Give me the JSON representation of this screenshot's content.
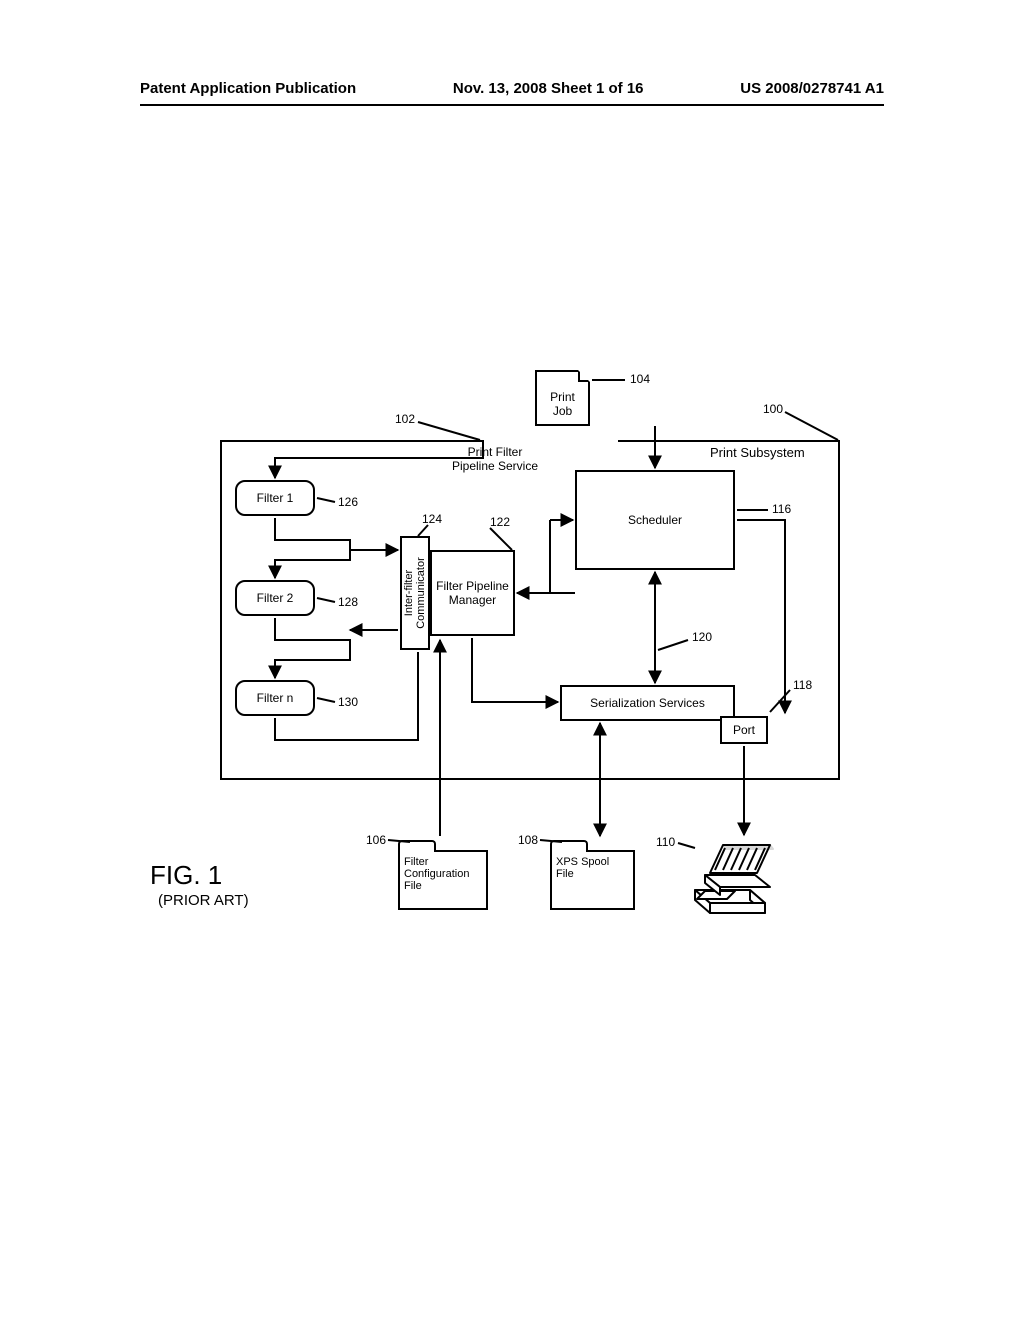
{
  "header": {
    "left": "Patent Application Publication",
    "center": "Nov. 13, 2008  Sheet 1 of 16",
    "right": "US 2008/0278741 A1"
  },
  "figure": {
    "caption": "FIG. 1",
    "subcaption": "(PRIOR ART)"
  },
  "boxes": {
    "print_subsystem": "Print Subsystem",
    "print_filter_pipeline_service": "Print Filter\nPipeline Service",
    "print_job": "Print\nJob",
    "scheduler": "Scheduler",
    "filter_pipeline_manager": "Filter Pipeline\nManager",
    "inter_filter_communicator": "Inter-filter\nCommunicator",
    "serialization_services": "Serialization Services",
    "filter_1": "Filter 1",
    "filter_2": "Filter 2",
    "filter_n": "Filter n",
    "port": "Port",
    "filter_config_file": "Filter\nConfiguration\nFile",
    "xps_spool_file": "XPS Spool\nFile"
  },
  "refs": {
    "r100": "100",
    "r102": "102",
    "r104": "104",
    "r106": "106",
    "r108": "108",
    "r110": "110",
    "r116": "116",
    "r118": "118",
    "r120": "120",
    "r122": "122",
    "r124": "124",
    "r126": "126",
    "r128": "128",
    "r130": "130"
  }
}
